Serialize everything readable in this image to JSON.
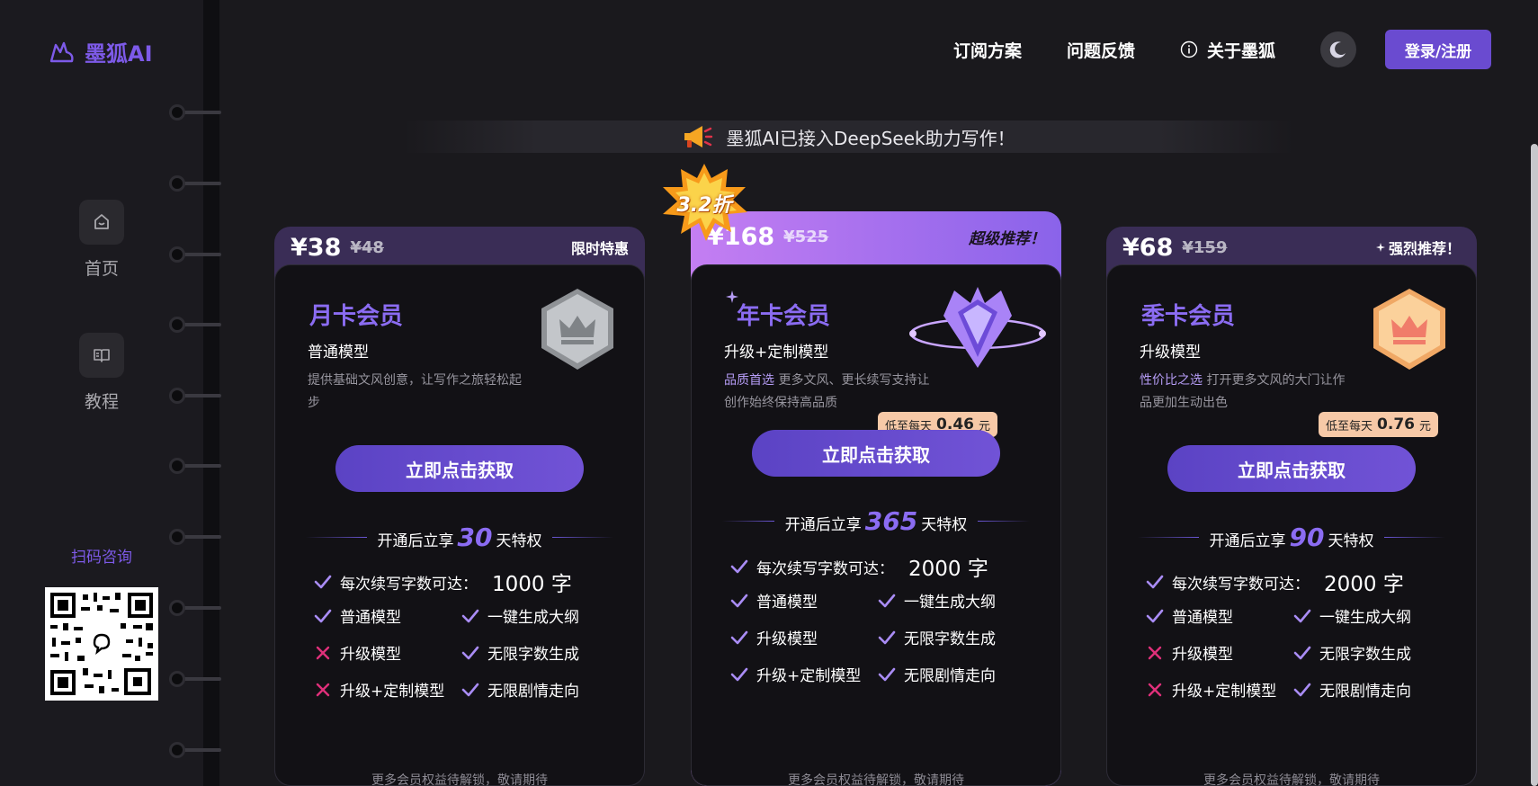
{
  "brand": {
    "name": "墨狐AI"
  },
  "sidebar": {
    "items": [
      {
        "label": "首页",
        "icon": "home-icon"
      },
      {
        "label": "教程",
        "icon": "book-icon"
      }
    ],
    "scan_label": "扫码咨询"
  },
  "header": {
    "links": [
      "订阅方案",
      "问题反馈",
      "关于墨狐"
    ],
    "login_label": "登录/注册"
  },
  "announcement": "墨狐AI已接入DeepSeek助力写作！",
  "discount_badge": "3.2折",
  "plans": [
    {
      "price": "¥38",
      "old_price": "¥48",
      "tag": "限时特惠",
      "title": "月卡会员",
      "subtitle": "普通模型",
      "desc_highlight": "",
      "desc": "提供基础文风创意，让写作之旅轻松起步",
      "daily_prefix": "",
      "daily_value": "",
      "daily_unit": "",
      "button": "立即点击获取",
      "perk_prefix": "开通后立享",
      "perk_days": "30",
      "perk_suffix": "天特权",
      "word_limit_label": "每次续写字数可达：",
      "word_limit": "1000 字",
      "features": [
        {
          "label": "普通模型",
          "ok": true
        },
        {
          "label": "一键生成大纲",
          "ok": true
        },
        {
          "label": "升级模型",
          "ok": false
        },
        {
          "label": "无限字数生成",
          "ok": true
        },
        {
          "label": "升级+定制模型",
          "ok": false
        },
        {
          "label": "无限剧情走向",
          "ok": true
        }
      ],
      "footnote": "更多会员权益待解锁，敬请期待"
    },
    {
      "price": "¥168",
      "old_price": "¥525",
      "tag": "超级推荐！",
      "title": "年卡会员",
      "subtitle": "升级+定制模型",
      "desc_highlight": "品质首选",
      "desc": "更多文风、更长续写支持让创作始终保持高品质",
      "daily_prefix": "低至每天",
      "daily_value": "0.46",
      "daily_unit": "元",
      "button": "立即点击获取",
      "perk_prefix": "开通后立享",
      "perk_days": "365",
      "perk_suffix": "天特权",
      "word_limit_label": "每次续写字数可达：",
      "word_limit": "2000 字",
      "features": [
        {
          "label": "普通模型",
          "ok": true
        },
        {
          "label": "一键生成大纲",
          "ok": true
        },
        {
          "label": "升级模型",
          "ok": true
        },
        {
          "label": "无限字数生成",
          "ok": true
        },
        {
          "label": "升级+定制模型",
          "ok": true
        },
        {
          "label": "无限剧情走向",
          "ok": true
        }
      ],
      "footnote": "更多会员权益待解锁，敬请期待"
    },
    {
      "price": "¥68",
      "old_price": "¥159",
      "tag": "强烈推荐！",
      "title": "季卡会员",
      "subtitle": "升级模型",
      "desc_highlight": "性价比之选",
      "desc": "打开更多文风的大门让作品更加生动出色",
      "daily_prefix": "低至每天",
      "daily_value": "0.76",
      "daily_unit": "元",
      "button": "立即点击获取",
      "perk_prefix": "开通后立享",
      "perk_days": "90",
      "perk_suffix": "天特权",
      "word_limit_label": "每次续写字数可达：",
      "word_limit": "2000 字",
      "features": [
        {
          "label": "普通模型",
          "ok": true
        },
        {
          "label": "一键生成大纲",
          "ok": true
        },
        {
          "label": "升级模型",
          "ok": false
        },
        {
          "label": "无限字数生成",
          "ok": true
        },
        {
          "label": "升级+定制模型",
          "ok": false
        },
        {
          "label": "无限剧情走向",
          "ok": true
        }
      ],
      "footnote": "更多会员权益待解锁，敬请期待"
    }
  ],
  "colors": {
    "accent": "#7d5ae8",
    "background": "#1a191d",
    "card_body": "#121115",
    "check": "#a98cf5",
    "cross": "#e0307a"
  }
}
